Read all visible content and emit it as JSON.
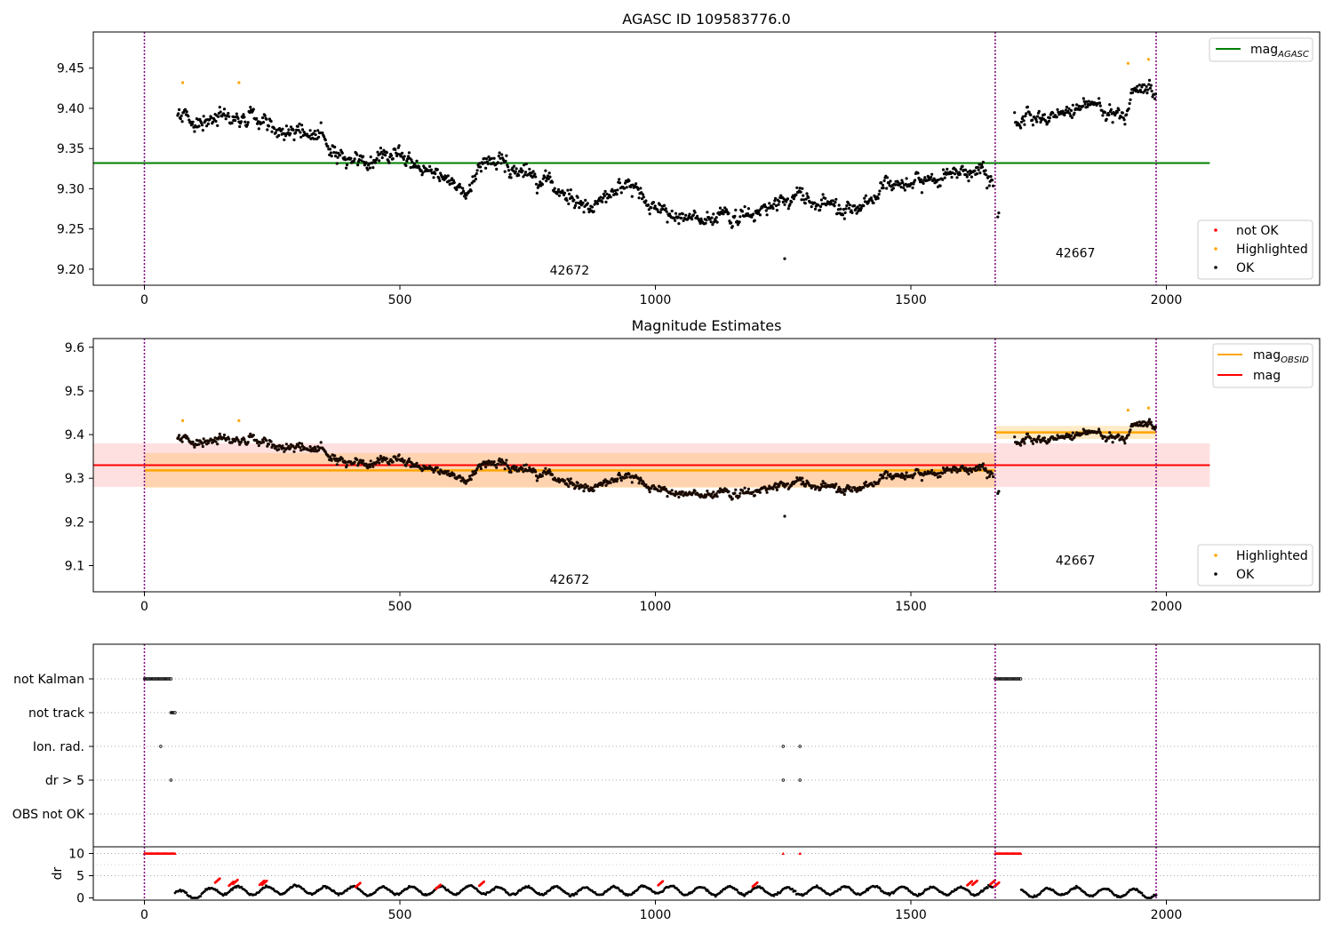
{
  "chart_data": [
    {
      "type": "scatter",
      "title": "AGASC ID 109583776.0",
      "xlim": [
        -100,
        2300
      ],
      "ylim": [
        9.18,
        9.495
      ],
      "xticks": [
        0,
        500,
        1000,
        1500,
        2000
      ],
      "yticks": [
        9.2,
        9.25,
        9.3,
        9.35,
        9.4,
        9.45
      ],
      "ytick_labels": [
        "9.20",
        "9.25",
        "9.30",
        "9.35",
        "9.40",
        "9.45"
      ],
      "obs_boundaries": [
        0,
        1665,
        1980
      ],
      "obsid_labels": [
        {
          "text": "42672",
          "x": 832,
          "y": 9.193
        },
        {
          "text": "42667",
          "x": 1822,
          "y": 9.215
        }
      ],
      "hlines": [
        {
          "name": "mag_AGASC",
          "y": 9.332,
          "x": [
            -100,
            2085
          ],
          "color": "#008000"
        }
      ],
      "ok_trend": {
        "color": "#000000",
        "points": [
          [
            65,
            9.39
          ],
          [
            100,
            9.38
          ],
          [
            150,
            9.39
          ],
          [
            200,
            9.385
          ],
          [
            250,
            9.38
          ],
          [
            300,
            9.37
          ],
          [
            350,
            9.36
          ],
          [
            400,
            9.33
          ],
          [
            450,
            9.33
          ],
          [
            500,
            9.34
          ],
          [
            550,
            9.32
          ],
          [
            600,
            9.31
          ],
          [
            630,
            9.29
          ],
          [
            660,
            9.33
          ],
          [
            700,
            9.335
          ],
          [
            750,
            9.315
          ],
          [
            800,
            9.305
          ],
          [
            850,
            9.28
          ],
          [
            900,
            9.29
          ],
          [
            950,
            9.305
          ],
          [
            970,
            9.29
          ],
          [
            1000,
            9.28
          ],
          [
            1050,
            9.26
          ],
          [
            1100,
            9.27
          ],
          [
            1150,
            9.265
          ],
          [
            1200,
            9.275
          ],
          [
            1250,
            9.29
          ],
          [
            1300,
            9.285
          ],
          [
            1350,
            9.28
          ],
          [
            1400,
            9.275
          ],
          [
            1430,
            9.285
          ],
          [
            1450,
            9.305
          ],
          [
            1500,
            9.31
          ],
          [
            1550,
            9.315
          ],
          [
            1600,
            9.325
          ],
          [
            1640,
            9.325
          ],
          [
            1665,
            9.3
          ],
          [
            1705,
            9.39
          ],
          [
            1750,
            9.39
          ],
          [
            1800,
            9.4
          ],
          [
            1850,
            9.4
          ],
          [
            1900,
            9.395
          ],
          [
            1920,
            9.39
          ],
          [
            1935,
            9.43
          ],
          [
            1960,
            9.43
          ],
          [
            1980,
            9.42
          ]
        ]
      },
      "outliers": [
        [
          1253,
          9.213
        ],
        [
          1670,
          9.265
        ],
        [
          1672,
          9.27
        ]
      ],
      "highlighted": {
        "name": "Highlighted",
        "color": "#ffa500",
        "points": [
          [
            75,
            9.432
          ],
          [
            185,
            9.432
          ],
          [
            1925,
            9.456
          ],
          [
            1965,
            9.461
          ]
        ]
      },
      "not_ok": {
        "name": "not OK",
        "color": "#ff0000",
        "points": []
      },
      "legend_upper": [
        {
          "label": "mag",
          "sub": "AGASC",
          "color": "#008000"
        }
      ],
      "legend_lower": [
        {
          "label": "not OK",
          "color": "#ff0000"
        },
        {
          "label": "Highlighted",
          "color": "#ffa500"
        },
        {
          "label": "OK",
          "color": "#000000"
        }
      ]
    },
    {
      "type": "scatter",
      "title": "Magnitude Estimates",
      "xlim": [
        -100,
        2300
      ],
      "ylim": [
        9.04,
        9.62
      ],
      "xticks": [
        0,
        500,
        1000,
        1500,
        2000
      ],
      "yticks": [
        9.1,
        9.2,
        9.3,
        9.4,
        9.5,
        9.6
      ],
      "ytick_labels": [
        "9.1",
        "9.2",
        "9.3",
        "9.4",
        "9.5",
        "9.6"
      ],
      "obs_boundaries": [
        0,
        1665,
        1980
      ],
      "obsid_labels": [
        {
          "text": "42672",
          "x": 832,
          "y": 9.058
        },
        {
          "text": "42667",
          "x": 1822,
          "y": 9.102
        }
      ],
      "mag": {
        "name": "mag",
        "y": 9.33,
        "band": [
          9.28,
          9.38
        ],
        "x": [
          0,
          2085
        ],
        "color": "#ff0000"
      },
      "mag_obsid": [
        {
          "y": 9.318,
          "band": [
            9.278,
            9.358
          ],
          "x": [
            0,
            1665
          ],
          "color": "#ffa500"
        },
        {
          "y": 9.405,
          "band": [
            9.39,
            9.42
          ],
          "x": [
            1665,
            1980
          ],
          "color": "#ffa500"
        }
      ],
      "legend_upper": [
        {
          "label": "mag",
          "sub": "OBSID",
          "color": "#ffa500"
        },
        {
          "label": "mag",
          "sub": "",
          "color": "#ff0000"
        }
      ],
      "legend_lower": [
        {
          "label": "Highlighted",
          "color": "#ffa500"
        },
        {
          "label": "OK",
          "color": "#000000"
        }
      ]
    },
    {
      "type": "scatter",
      "title": "",
      "xlim": [
        -100,
        2300
      ],
      "xticks": [
        0,
        500,
        1000,
        1500,
        2000
      ],
      "flag_rows": [
        "not Kalman",
        "not track",
        "Ion. rad.",
        "dr > 5",
        "OBS not OK"
      ],
      "flags": {
        "not Kalman": [
          [
            0,
            52
          ],
          [
            1665,
            1715
          ]
        ],
        "not track": [
          [
            52,
            60
          ]
        ],
        "Ion. rad.": [
          [
            32,
            32
          ],
          [
            1250,
            1250
          ],
          [
            1283,
            1283
          ]
        ],
        "dr > 5": [
          [
            52,
            52
          ],
          [
            1250,
            1250
          ],
          [
            1283,
            1283
          ]
        ],
        "OBS not OK": []
      },
      "dr": {
        "ylabel": "dr",
        "ylim": [
          -0.5,
          11.5
        ],
        "yticks": [
          0,
          5,
          10
        ],
        "ytick_labels": [
          "0",
          "5",
          "10"
        ],
        "saturated_value": 10,
        "saturated_ranges": [
          [
            0,
            60
          ],
          [
            1250,
            1250
          ],
          [
            1283,
            1283
          ],
          [
            1665,
            1715
          ]
        ],
        "red_points": [
          [
            143,
            3.9
          ],
          [
            170,
            3.2
          ],
          [
            178,
            3.6
          ],
          [
            230,
            3.4
          ],
          [
            235,
            3.4
          ],
          [
            418,
            2.9
          ],
          [
            575,
            2.5
          ],
          [
            660,
            3.2
          ],
          [
            1010,
            3.3
          ],
          [
            1195,
            3.0
          ],
          [
            1615,
            3.3
          ],
          [
            1625,
            3.4
          ],
          [
            1660,
            3.5
          ],
          [
            1668,
            3.0
          ]
        ],
        "trend": [
          [
            60,
            0.8
          ],
          [
            100,
            0.6
          ],
          [
            150,
            1.8
          ],
          [
            200,
            1.5
          ],
          [
            250,
            1.7
          ],
          [
            300,
            2.0
          ],
          [
            350,
            1.6
          ],
          [
            400,
            1.8
          ],
          [
            450,
            1.4
          ],
          [
            500,
            1.8
          ],
          [
            550,
            1.5
          ],
          [
            600,
            1.7
          ],
          [
            650,
            1.9
          ],
          [
            700,
            1.5
          ],
          [
            750,
            1.7
          ],
          [
            800,
            1.6
          ],
          [
            850,
            1.4
          ],
          [
            900,
            1.6
          ],
          [
            950,
            1.5
          ],
          [
            1000,
            2.0
          ],
          [
            1050,
            1.6
          ],
          [
            1100,
            1.5
          ],
          [
            1150,
            1.7
          ],
          [
            1200,
            1.6
          ],
          [
            1250,
            1.4
          ],
          [
            1300,
            1.5
          ],
          [
            1350,
            1.7
          ],
          [
            1400,
            1.6
          ],
          [
            1450,
            1.8
          ],
          [
            1500,
            1.5
          ],
          [
            1550,
            1.6
          ],
          [
            1600,
            1.5
          ],
          [
            1650,
            1.7
          ],
          [
            1715,
            1.2
          ],
          [
            1750,
            1.0
          ],
          [
            1800,
            1.6
          ],
          [
            1850,
            1.3
          ],
          [
            1900,
            1.2
          ],
          [
            1950,
            1.0
          ],
          [
            1980,
            0.6
          ]
        ]
      }
    }
  ]
}
